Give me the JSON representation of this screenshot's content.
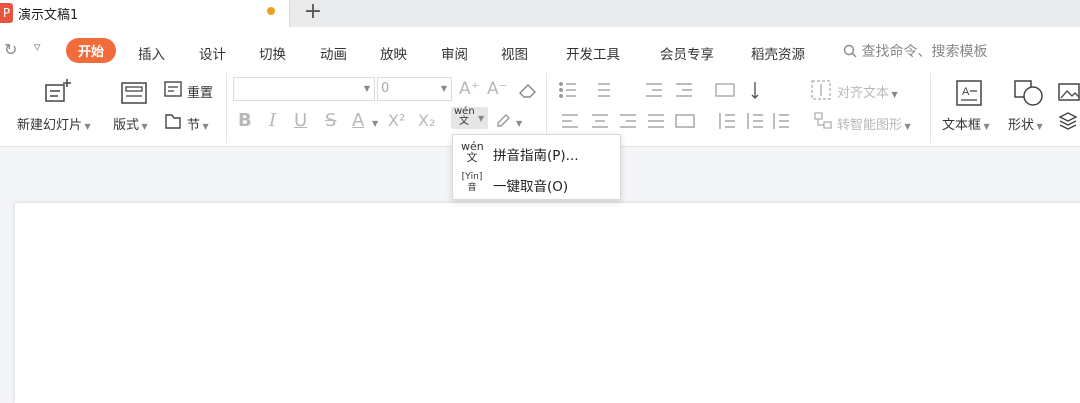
{
  "tabbar": {
    "app_logo": "P",
    "doc_title": "演示文稿1",
    "new_tab": "+"
  },
  "menu": {
    "redo_icon": "↻",
    "more_icon": "▿",
    "items": [
      "开始",
      "插入",
      "设计",
      "切换",
      "动画",
      "放映",
      "审阅",
      "视图",
      "开发工具",
      "会员专享",
      "稻壳资源"
    ],
    "active": "开始",
    "search": "查找命令、搜索模板",
    "search_icon": "search-icon"
  },
  "ribbon": {
    "new_slide": "新建幻灯片",
    "layout": "版式",
    "reset": "重置",
    "section": "节",
    "font_name": "",
    "font_size": "0",
    "grow_font": "A⁺",
    "shrink_font": "A⁻",
    "bold": "B",
    "italic": "I",
    "underline": "U",
    "strike": "S",
    "font_color": "A",
    "superscript": "X²",
    "subscript": "X₂",
    "pinyin": "wén\n文",
    "align_text": "对齐文本",
    "smartart": "转智能图形",
    "textbox": "文本框",
    "shape": "形状"
  },
  "pinyin_menu": {
    "items": [
      {
        "icon": "wén\n文",
        "label": "拼音指南(P)..."
      },
      {
        "icon": "[Yīn]\n音",
        "label": "一键取音(O)"
      }
    ]
  },
  "colors": {
    "accent": "#f26b3a",
    "unsaved": "#f0a020",
    "logo": "#e8553e"
  }
}
